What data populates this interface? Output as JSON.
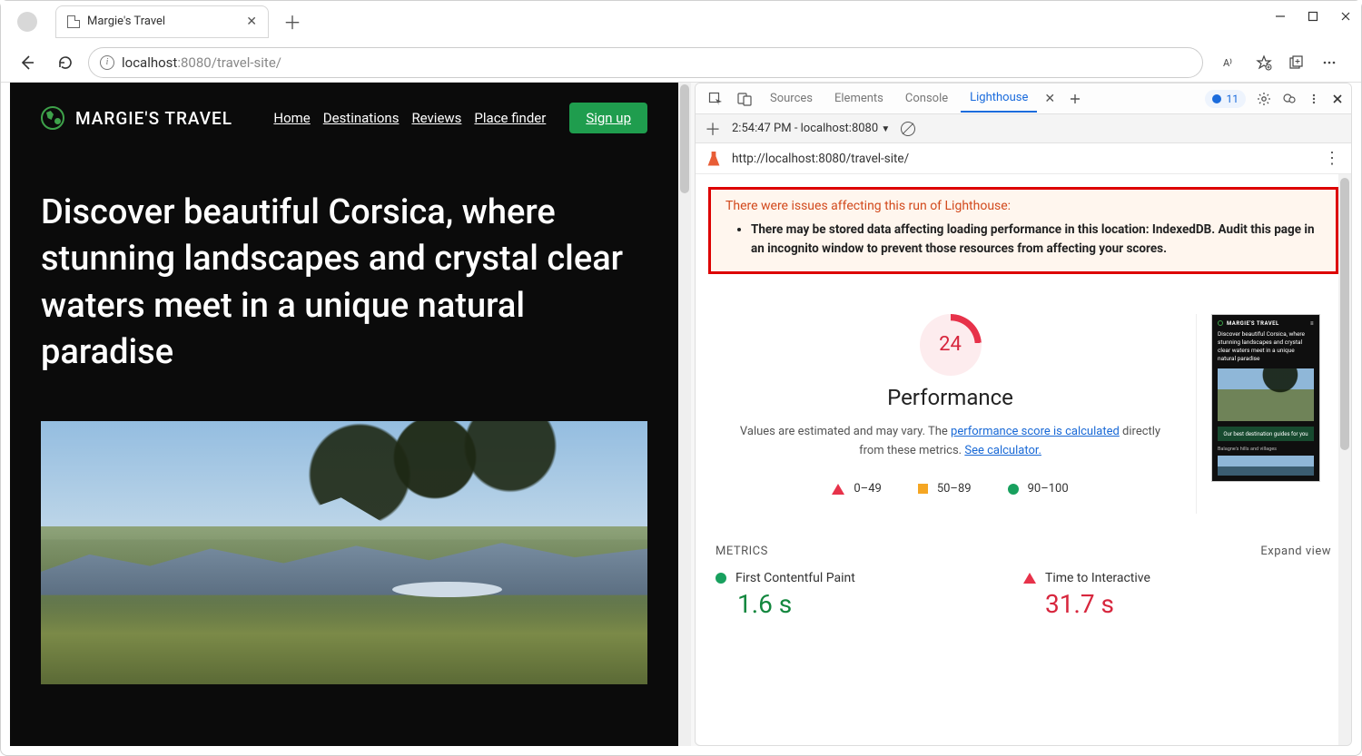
{
  "browser": {
    "tab_title": "Margie's Travel",
    "url_display_host": "localhost",
    "url_display_port": ":8080",
    "url_display_path": "/travel-site/",
    "issues_count": "11"
  },
  "site": {
    "brand": "MARGIE'S TRAVEL",
    "nav": {
      "home": "Home",
      "destinations": "Destinations",
      "reviews": "Reviews",
      "placefinder": "Place finder"
    },
    "signup": "Sign up",
    "hero": "Discover beautiful Corsica, where stunning landscapes and crystal clear waters meet in a unique natural paradise"
  },
  "devtools": {
    "tabs": {
      "sources": "Sources",
      "elements": "Elements",
      "console": "Console",
      "lighthouse": "Lighthouse"
    },
    "session_label": "2:54:47 PM - localhost:8080",
    "audited_url": "http://localhost:8080/travel-site/"
  },
  "lighthouse": {
    "warning_title": "There were issues affecting this run of Lighthouse:",
    "warning_item": "There may be stored data affecting loading performance in this location: IndexedDB. Audit this page in an incognito window to prevent those resources from affecting your scores.",
    "score": "24",
    "score_title": "Performance",
    "desc_pre": "Values are estimated and may vary. The ",
    "desc_link1": "performance score is calculated",
    "desc_mid": " directly from these metrics. ",
    "desc_link2": "See calculator.",
    "legend": {
      "low": "0–49",
      "mid": "50–89",
      "high": "90–100"
    },
    "metrics_label": "METRICS",
    "expand_label": "Expand view",
    "metric1_name": "First Contentful Paint",
    "metric1_value": "1.6 s",
    "metric2_name": "Time to Interactive",
    "metric2_value": "31.7 s",
    "thumb": {
      "brand": "MARGIE'S TRAVEL",
      "hero": "Discover beautiful Corsica, where stunning landscapes and crystal clear waters meet in a unique natural paradise",
      "band": "Our best destination guides for you",
      "sub": "Balagne's hills and villages"
    }
  }
}
